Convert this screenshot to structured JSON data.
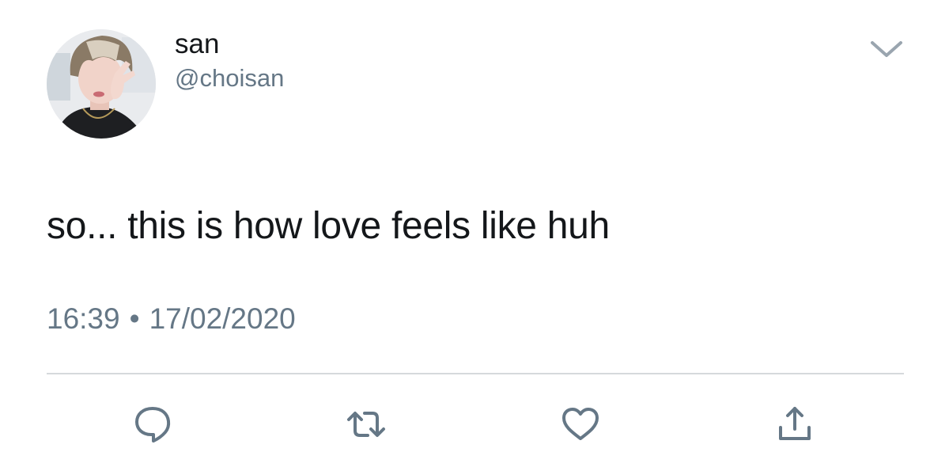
{
  "tweet": {
    "author": {
      "display_name": "san",
      "handle": "@choisan"
    },
    "text": "so... this is how love feels like huh",
    "time": "16:39",
    "separator": "•",
    "date": "17/02/2020"
  },
  "icons": {
    "menu": "chevron-down-icon",
    "reply": "speech-bubble-icon",
    "retweet": "retweet-icon",
    "like": "heart-icon",
    "share": "share-icon"
  },
  "colors": {
    "text": "#14171a",
    "secondary": "#657786",
    "icon": "#657786",
    "divider": "#d6d9dc"
  }
}
